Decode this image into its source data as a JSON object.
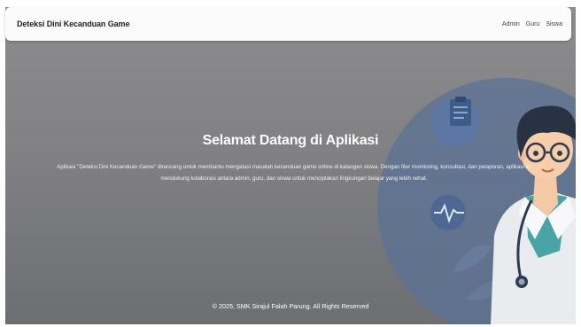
{
  "navbar": {
    "brand": "Deteksi Dini Kecanduan Game",
    "links": [
      "Admin",
      "Guru",
      "Siswa"
    ]
  },
  "hero": {
    "title": "Selamat Datang di Aplikasi",
    "description": "Aplikasi \"Deteksi Dini Kecanduan Game\" dirancang untuk membantu mengatasi masalah kecanduan game online di kalangan siswa. Dengan fitur monitoring, konsultasi, dan pelaporan, aplikasi ini mendukung kolaborasi antara admin, guru, dan siswa untuk menciptakan lingkungan belajar yang lebih sehat."
  },
  "footer": {
    "copyright": "© 2025, SMK Sirajul Falah Parung. All Rights Reserved"
  },
  "colors": {
    "overlay": "#828285",
    "navbar_bg": "#fbfbfb",
    "illustration_blue": "#4e6d9a",
    "coat": "#eef0f2",
    "scrub": "#4aa3a6"
  },
  "icons": {
    "clipboard": "clipboard-icon",
    "heartbeat": "heartbeat-icon",
    "doctor": "doctor-illustration"
  }
}
